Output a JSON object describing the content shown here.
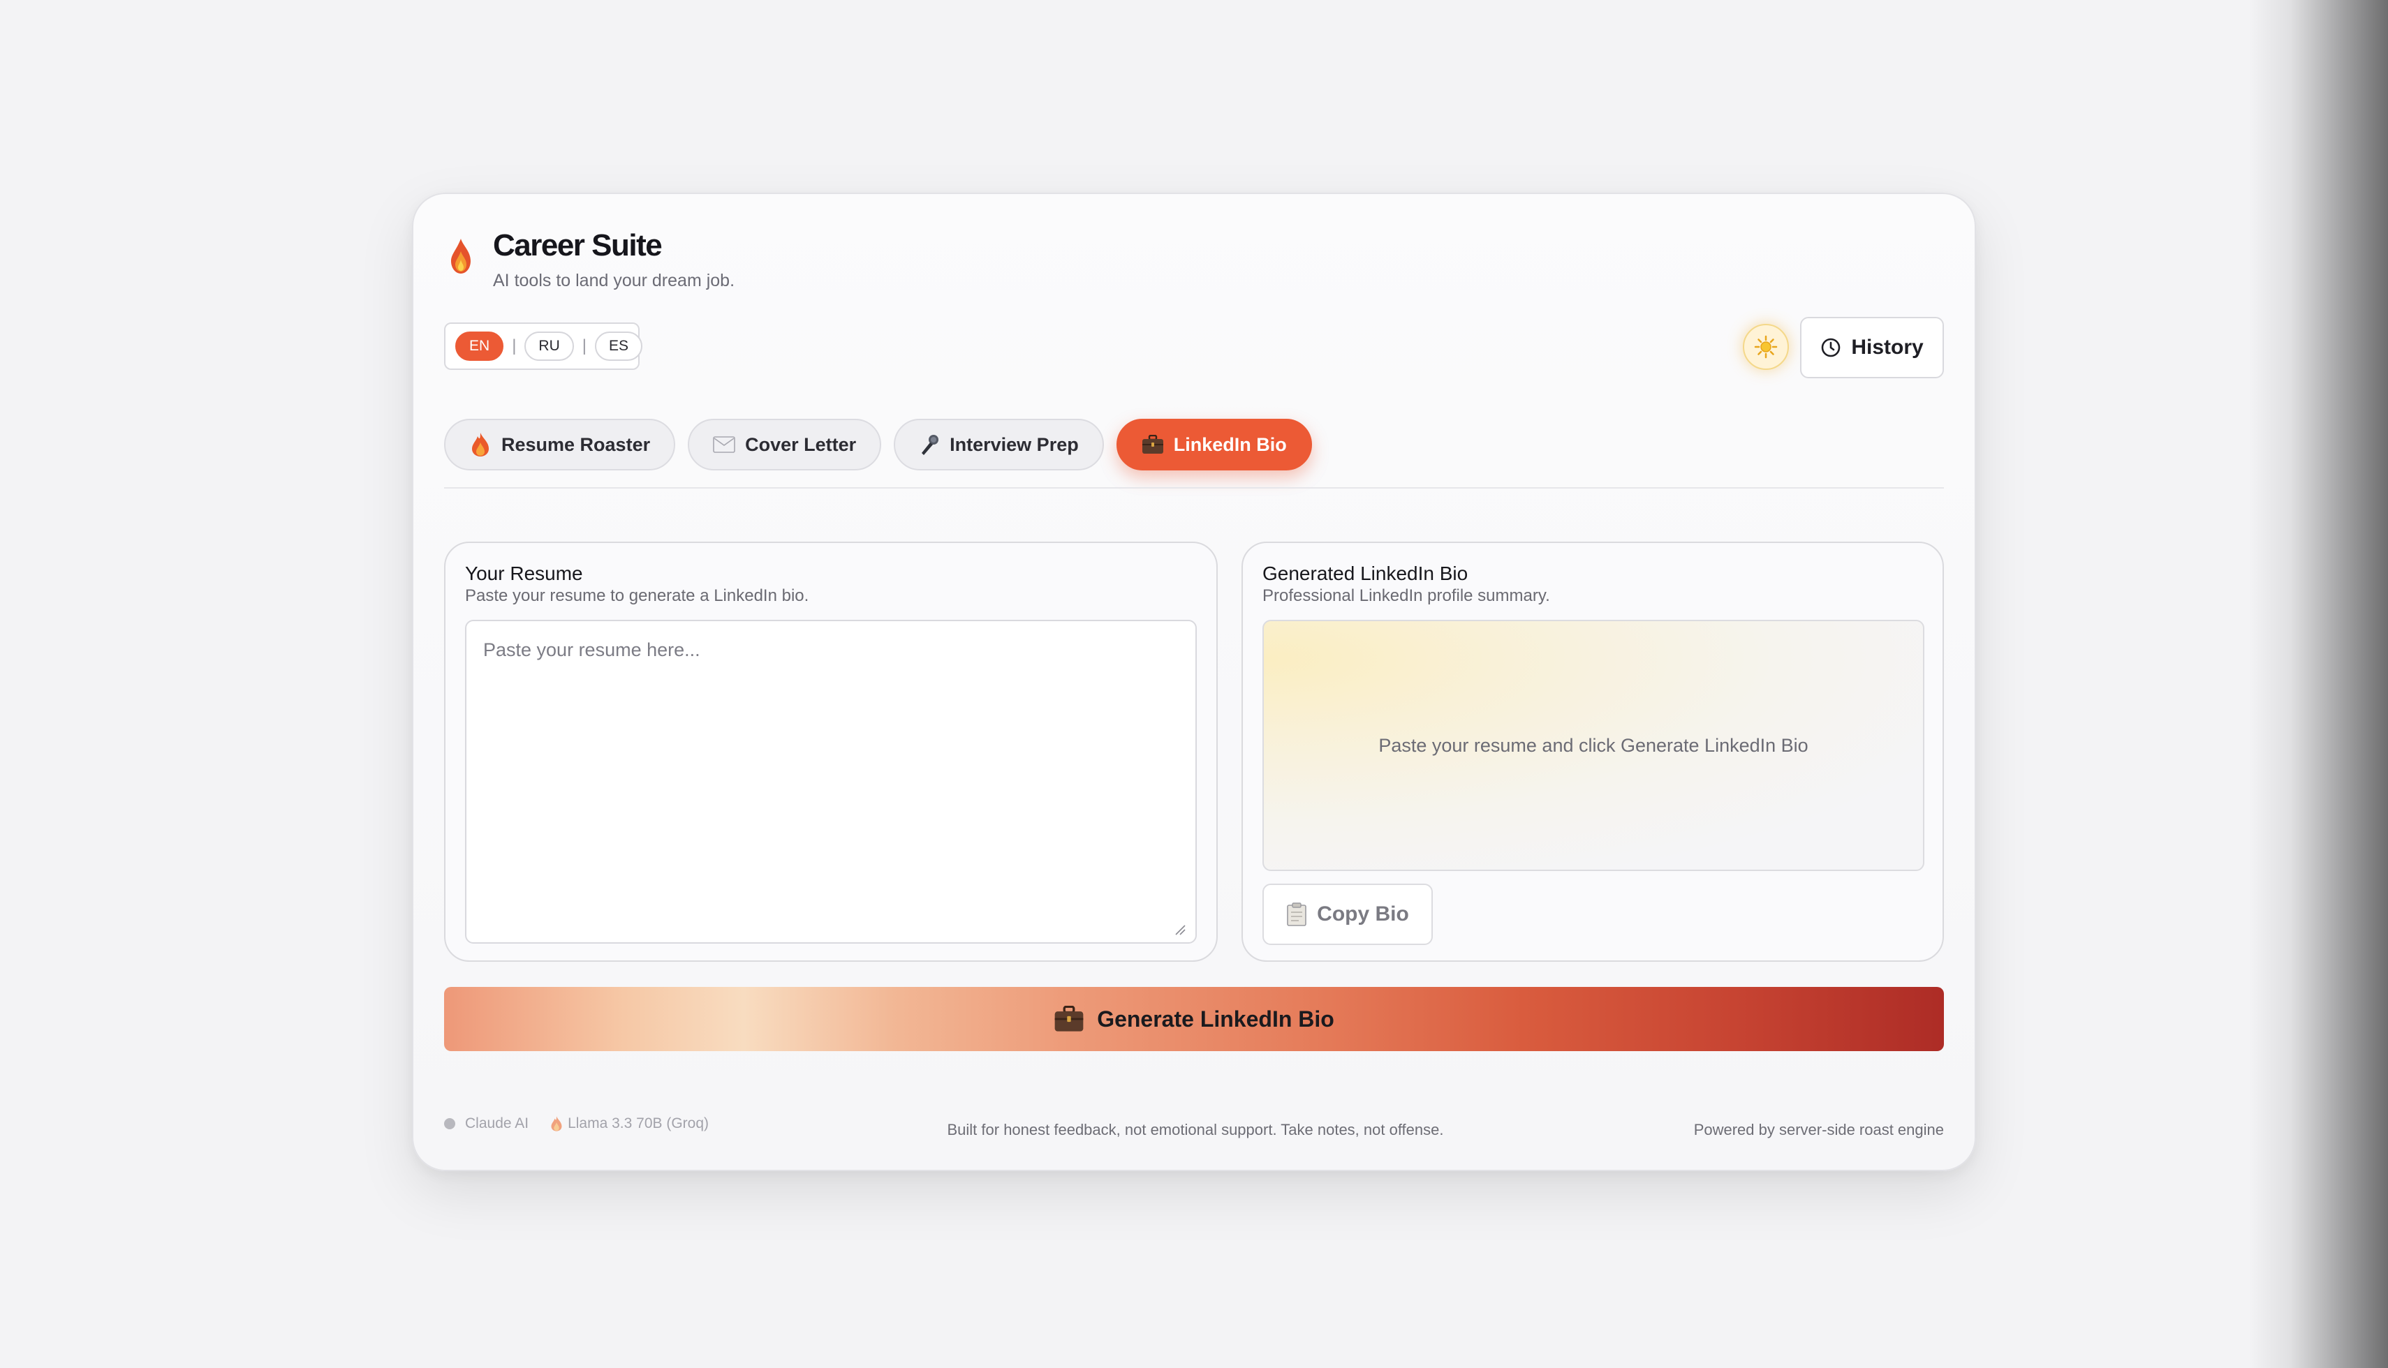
{
  "app": {
    "title": "Career Suite",
    "subtitle": "AI tools to land your dream job."
  },
  "languages": {
    "items": [
      "EN",
      "RU",
      "ES"
    ],
    "selected": "EN",
    "separator": "|"
  },
  "header_actions": {
    "theme_icon": "sun-icon",
    "history_label": "History"
  },
  "tabs": [
    {
      "label": "Resume Roaster",
      "icon": "fire-icon",
      "active": false
    },
    {
      "label": "Cover Letter",
      "icon": "envelope-icon",
      "active": false
    },
    {
      "label": "Interview Prep",
      "icon": "microphone-icon",
      "active": false
    },
    {
      "label": "LinkedIn Bio",
      "icon": "briefcase-icon",
      "active": true
    }
  ],
  "input_panel": {
    "title": "Your Resume",
    "description": "Paste your resume to generate a LinkedIn bio.",
    "placeholder": "Paste your resume here..."
  },
  "output_panel": {
    "title": "Generated LinkedIn Bio",
    "description": "Professional LinkedIn profile summary.",
    "placeholder": "Paste your resume and click Generate LinkedIn Bio",
    "copy_label": "Copy Bio"
  },
  "generate_button": {
    "label": "Generate LinkedIn Bio"
  },
  "footer": {
    "model_primary": "Claude AI",
    "model_secondary": "Llama 3.3 70B (Groq)",
    "tagline": "Built for honest feedback, not emotional support. Take notes, not offense.",
    "powered_by": "Powered by server-side roast engine"
  },
  "colors": {
    "accent": "#ec5a35",
    "background": "#f3f3f5",
    "card": "#fafafc"
  }
}
